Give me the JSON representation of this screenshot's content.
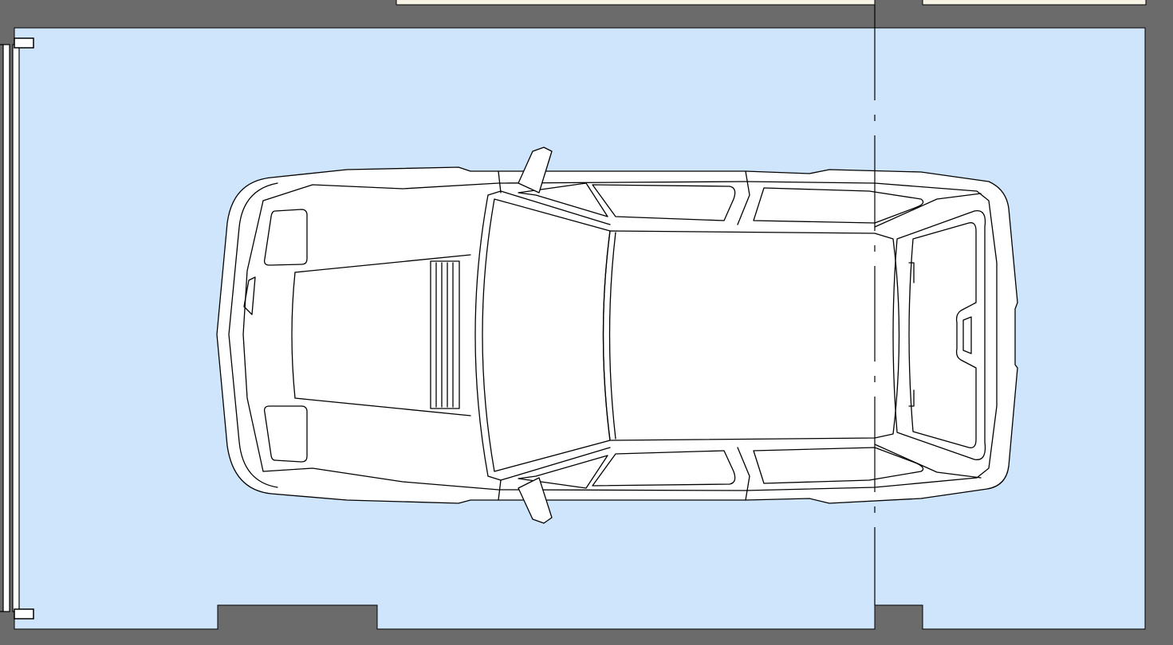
{
  "plan": {
    "colors": {
      "wall": "#6b6b6b",
      "floor": "#cfe5fc",
      "adjacent_room": "#f7f4e6",
      "car_body": "#ffffff",
      "line": "#000000"
    },
    "elements": [
      "garage-floor",
      "garage-door",
      "car-top-view",
      "grid-axis-line"
    ]
  }
}
